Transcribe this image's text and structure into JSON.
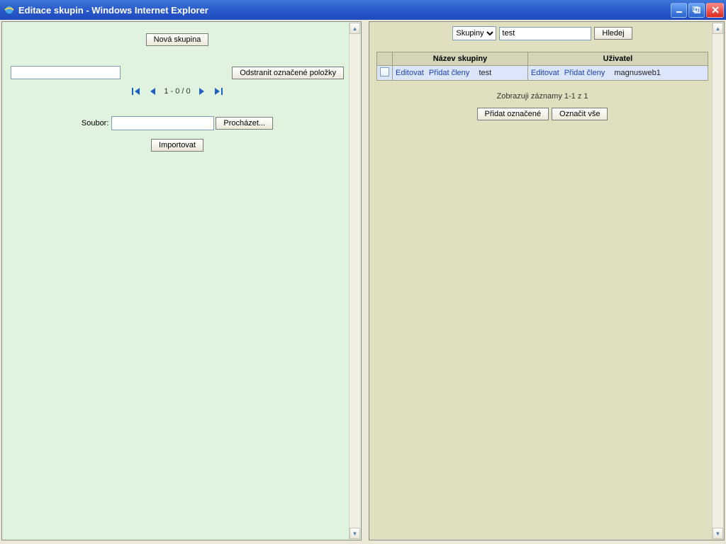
{
  "window": {
    "title": "Editace skupin - Windows Internet Explorer"
  },
  "left": {
    "new_group": "Nová skupina",
    "delete_marked": "Odstranit označené položky",
    "pager": "1 - 0 / 0",
    "file_label": "Soubor:",
    "browse": "Procházet...",
    "import": "Importovat"
  },
  "right": {
    "search_type_options": [
      "Skupiny"
    ],
    "search_type": "Skupiny",
    "search_value": "test",
    "search_btn": "Hledej",
    "col_name": "Název skupiny",
    "col_user": "Uživatel",
    "rows": [
      {
        "edit1": "Editovat",
        "add1": "Přidat členy",
        "name": "test",
        "edit2": "Editovat",
        "add2": "Přidat členy",
        "user": "magnusweb1"
      }
    ],
    "status": "Zobrazuji záznamy 1-1 z 1",
    "add_marked": "Přidat označené",
    "mark_all": "Označit vše"
  }
}
